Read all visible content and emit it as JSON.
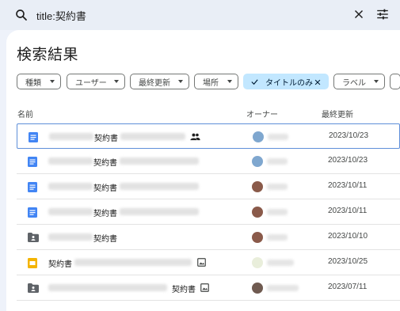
{
  "search": {
    "query": "title:契約書"
  },
  "page": {
    "title": "検索結果"
  },
  "filters": [
    {
      "label": "種類",
      "active": false
    },
    {
      "label": "ユーザー",
      "active": false
    },
    {
      "label": "最終更新",
      "active": false
    },
    {
      "label": "場所",
      "active": false
    },
    {
      "label": "タイトルのみ",
      "active": true
    },
    {
      "label": "ラベル",
      "active": false
    }
  ],
  "columns": {
    "name": "名前",
    "owner": "オーナー",
    "modified": "最終更新"
  },
  "rows": [
    {
      "name": "契約書",
      "type": "doc",
      "date": "2023/10/23",
      "shared": true,
      "avatar_color": "#7fa7cf"
    },
    {
      "name": "契約書",
      "type": "doc",
      "date": "2023/10/23",
      "avatar_color": "#7fa7cf"
    },
    {
      "name": "契約書",
      "type": "doc",
      "date": "2023/10/11",
      "avatar_color": "#8a5a4a"
    },
    {
      "name": "契約書",
      "type": "doc",
      "date": "2023/10/11",
      "avatar_color": "#8a5a4a"
    },
    {
      "name": "契約書",
      "type": "folder",
      "date": "2023/10/10",
      "avatar_color": "#8a5a4a"
    },
    {
      "name": "契約書",
      "type": "slides",
      "date": "2023/10/25",
      "image_icon": true,
      "avatar_color": "#e9eedb"
    },
    {
      "name": "契約書",
      "type": "folder",
      "date": "2023/07/11",
      "image_icon": true,
      "avatar_color": "#6f5a50"
    }
  ],
  "colors": {
    "doc": "#4285f4",
    "folder": "#5f6368",
    "slides": "#f4b400",
    "accent_chip": "#c2e7ff"
  }
}
